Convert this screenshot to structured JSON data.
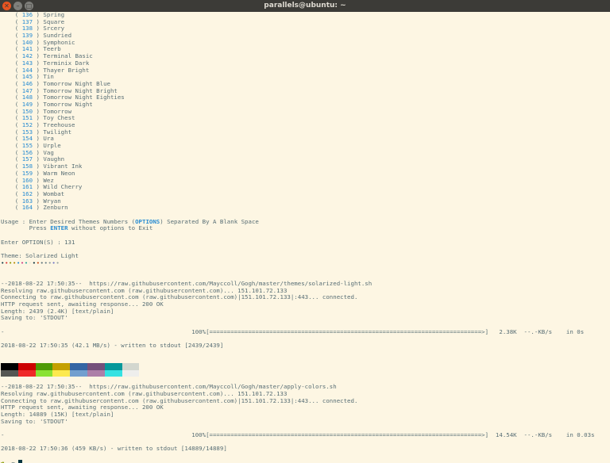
{
  "window": {
    "title": "parallels@ubuntu: ~"
  },
  "themes": [
    {
      "num": "136",
      "name": "Spring"
    },
    {
      "num": "137",
      "name": "Square"
    },
    {
      "num": "138",
      "name": "Srcery"
    },
    {
      "num": "139",
      "name": "Sundried"
    },
    {
      "num": "140",
      "name": "Symphonic"
    },
    {
      "num": "141",
      "name": "Teerb"
    },
    {
      "num": "142",
      "name": "Terminal Basic"
    },
    {
      "num": "143",
      "name": "Terminix Dark"
    },
    {
      "num": "144",
      "name": "Thayer Bright"
    },
    {
      "num": "145",
      "name": "Tin"
    },
    {
      "num": "146",
      "name": "Tomorrow Night Blue"
    },
    {
      "num": "147",
      "name": "Tomorrow Night Bright"
    },
    {
      "num": "148",
      "name": "Tomorrow Night Eighties"
    },
    {
      "num": "149",
      "name": "Tomorrow Night"
    },
    {
      "num": "150",
      "name": "Tomorrow"
    },
    {
      "num": "151",
      "name": "Toy Chest"
    },
    {
      "num": "152",
      "name": "Treehouse"
    },
    {
      "num": "153",
      "name": "Twilight"
    },
    {
      "num": "154",
      "name": "Ura"
    },
    {
      "num": "155",
      "name": "Urple"
    },
    {
      "num": "156",
      "name": "Vag"
    },
    {
      "num": "157",
      "name": "Vaughn"
    },
    {
      "num": "158",
      "name": "Vibrant Ink"
    },
    {
      "num": "159",
      "name": "Warm Neon"
    },
    {
      "num": "160",
      "name": "Wez"
    },
    {
      "num": "161",
      "name": "Wild Cherry"
    },
    {
      "num": "162",
      "name": "Wombat"
    },
    {
      "num": "163",
      "name": "Wryan"
    },
    {
      "num": "164",
      "name": "Zenburn"
    }
  ],
  "usage": {
    "line1_a": "Usage : Enter Desired Themes Numbers (",
    "line1_hl": "OPTIONS",
    "line1_b": ") Separated By A Blank Space",
    "line2_a": "        Press ",
    "line2_hl": "ENTER",
    "line2_b": " without options to Exit"
  },
  "enter_option": "Enter OPTION(S) : 131",
  "theme_line": "Theme: Solarized Light",
  "theme_dots": "••••••••",
  "theme_dot_colors": [
    "#073642",
    "#dc322f",
    "#859900",
    "#b58900",
    "#268bd2",
    "#d33682",
    "#2aa198",
    "#eee8d5",
    "#002b36",
    "#cb4b16",
    "#586e75",
    "#657b83",
    "#839496",
    "#6c71c4",
    "#93a1a1",
    "#fdf6e3"
  ],
  "download1": {
    "l1": "--2018-08-22 17:50:35--  https://raw.githubusercontent.com/Mayccoll/Gogh/master/themes/solarized-light.sh",
    "l2": "Resolving raw.githubusercontent.com (raw.githubusercontent.com)... 151.101.72.133",
    "l3": "Connecting to raw.githubusercontent.com (raw.githubusercontent.com)|151.101.72.133|:443... connected.",
    "l4": "HTTP request sent, awaiting response... 200 OK",
    "l5": "Length: 2439 (2.4K) [text/plain]",
    "l6": "Saving to: 'STDOUT'",
    "progress": "-                                                     100%[=============================================================================>]   2.38K  --.-KB/s    in 0s",
    "done": "2018-08-22 17:50:35 (42.1 MB/s) - written to stdout [2439/2439]"
  },
  "swatches_top": [
    "#000000",
    "#cc0000",
    "#4e9a06",
    "#c4a000",
    "#3465a4",
    "#75507b",
    "#06989a",
    "#d3d7cf"
  ],
  "swatches_bottom": [
    "#555753",
    "#ef2929",
    "#8ae234",
    "#fce94f",
    "#729fcf",
    "#ad7fa8",
    "#34e2e2",
    "#eeeeec"
  ],
  "download2": {
    "l1": "--2018-08-22 17:50:35--  https://raw.githubusercontent.com/Mayccoll/Gogh/master/apply-colors.sh",
    "l2": "Resolving raw.githubusercontent.com (raw.githubusercontent.com)... 151.101.72.133",
    "l3": "Connecting to raw.githubusercontent.com (raw.githubusercontent.com)|151.101.72.133|:443... connected.",
    "l4": "HTTP request sent, awaiting response... 200 OK",
    "l5": "Length: 14889 (15K) [text/plain]",
    "l6": "Saving to: 'STDOUT'",
    "progress": "-                                                     100%[=============================================================================>]  14.54K  --.-KB/s    in 0.03s",
    "done": "2018-08-22 17:50:36 (459 KB/s) - written to stdout [14889/14889]"
  },
  "prompt": {
    "arrow": "➜",
    "dir": "~"
  }
}
